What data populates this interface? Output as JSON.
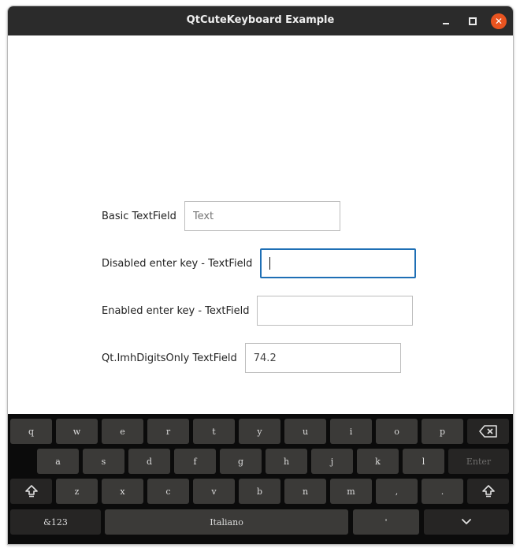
{
  "window": {
    "title": "QtCuteKeyboard Example",
    "minimize_icon": "minimize-icon",
    "maximize_icon": "maximize-icon",
    "close_icon": "close-icon",
    "close_color": "#e95420"
  },
  "form": {
    "rows": [
      {
        "label": "Basic TextField",
        "value": ""
      },
      {
        "label": "Disabled enter key - TextField",
        "value": ""
      },
      {
        "label": "Enabled enter key - TextField",
        "value": ""
      },
      {
        "label": "Qt.ImhDigitsOnly TextField",
        "value": "74.2"
      }
    ],
    "basic_placeholder": "Text",
    "focus_color": "#1e6fb5"
  },
  "keyboard": {
    "row1": [
      "q",
      "w",
      "e",
      "r",
      "t",
      "y",
      "u",
      "i",
      "o",
      "p"
    ],
    "row2": [
      "a",
      "s",
      "d",
      "f",
      "g",
      "h",
      "j",
      "k",
      "l"
    ],
    "enter_label": "Enter",
    "row3": [
      "z",
      "x",
      "c",
      "v",
      "b",
      "n",
      "m",
      ",",
      "."
    ],
    "symbols_label": "&123",
    "space_label": "Italiano",
    "apostrophe_label": "'",
    "backspace_icon": "backspace-icon",
    "shift_icon": "shift-icon",
    "hide_icon": "chevron-down-icon",
    "key_color": "#3b3a38",
    "background_color": "#0b0b0b"
  }
}
